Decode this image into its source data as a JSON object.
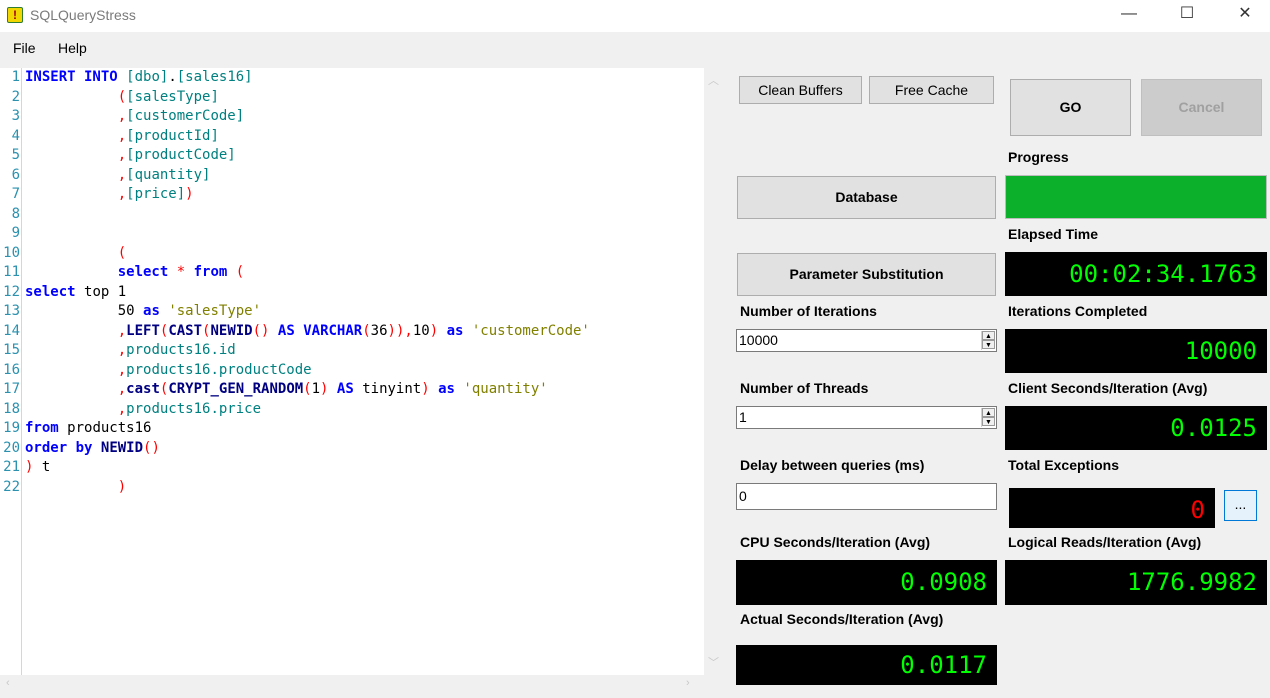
{
  "window": {
    "title": "SQLQueryStress",
    "min_glyph": "—",
    "max_glyph": "☐",
    "close_glyph": "✕"
  },
  "menu": {
    "file": "File",
    "help": "Help"
  },
  "editor": {
    "line_numbers": [
      "1",
      "2",
      "3",
      "4",
      "5",
      "6",
      "7",
      "8",
      "9",
      "10",
      "11",
      "12",
      "13",
      "14",
      "15",
      "16",
      "17",
      "18",
      "19",
      "20",
      "21",
      "22"
    ]
  },
  "buttons": {
    "clean_buffers": "Clean Buffers",
    "free_cache": "Free Cache",
    "go": "GO",
    "cancel": "Cancel",
    "database": "Database",
    "parameter_substitution": "Parameter Substitution",
    "exceptions_details": "..."
  },
  "labels": {
    "progress": "Progress",
    "elapsed_time": "Elapsed Time",
    "number_of_iterations": "Number of Iterations",
    "iterations_completed": "Iterations Completed",
    "number_of_threads": "Number of Threads",
    "client_seconds": "Client Seconds/Iteration (Avg)",
    "delay_between_queries": "Delay between queries (ms)",
    "total_exceptions": "Total Exceptions",
    "cpu_seconds": "CPU Seconds/Iteration (Avg)",
    "logical_reads": "Logical Reads/Iteration (Avg)",
    "actual_seconds": "Actual Seconds/Iteration (Avg)"
  },
  "inputs": {
    "iterations": "10000",
    "threads": "1",
    "delay": "0"
  },
  "stats": {
    "progress_fraction": 1.0,
    "elapsed_time": "00:02:34.1763",
    "iterations_completed": "10000",
    "client_seconds": "0.0125",
    "total_exceptions": "0",
    "cpu_seconds": "0.0908",
    "logical_reads": "1776.9982",
    "actual_seconds": "0.0117"
  },
  "colors": {
    "progress_fill": "#0cb02a",
    "lcd_text": "#00ff00",
    "exceptions_text": "#ff0000"
  }
}
